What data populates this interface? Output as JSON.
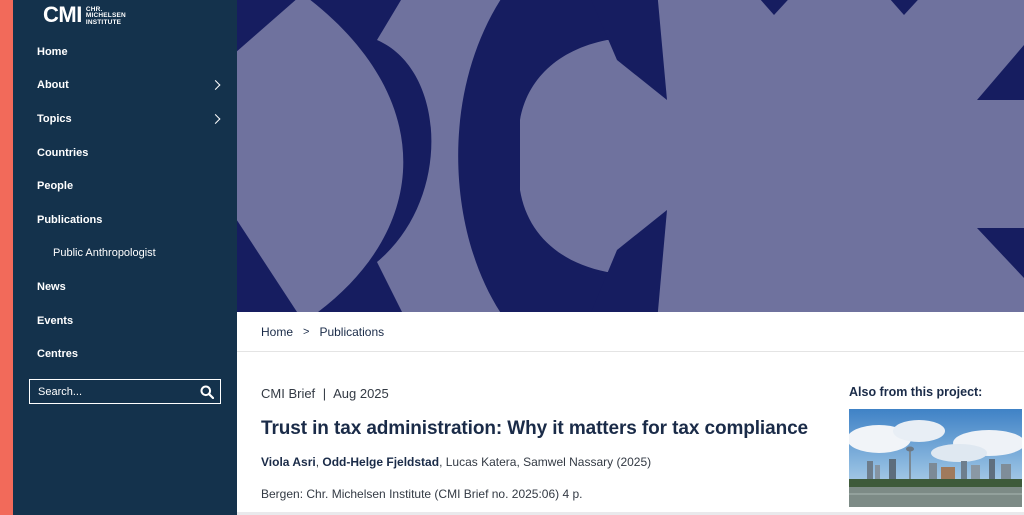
{
  "logo": {
    "mark": "CMI",
    "subtitle": "CHR.\nMICHELSEN\nINSTITUTE"
  },
  "nav": {
    "items": [
      {
        "label": "Home"
      },
      {
        "label": "About"
      },
      {
        "label": "Topics"
      },
      {
        "label": "Countries"
      },
      {
        "label": "People"
      },
      {
        "label": "Publications"
      },
      {
        "label": "Public Anthropologist"
      },
      {
        "label": "News"
      },
      {
        "label": "Events"
      },
      {
        "label": "Centres"
      }
    ]
  },
  "search": {
    "placeholder": "Search..."
  },
  "breadcrumb": {
    "home": "Home",
    "separator": ">",
    "current": "Publications"
  },
  "article": {
    "type": "CMI Brief",
    "divider": "|",
    "date": "Aug 2025",
    "title": "Trust in tax administration: Why it matters for tax compliance",
    "authors_linked": [
      "Viola Asri",
      "Odd-Helge Fjeldstad"
    ],
    "authors_rest": ", Lucas Katera, Samwel Nassary (2025)",
    "publication_info": "Bergen: Chr. Michelsen Institute (CMI Brief no. 2025:06) 4 p."
  },
  "aside": {
    "title": "Also from this project:"
  },
  "colors": {
    "sidebar": "#14324c",
    "accent": "#f26a5a",
    "hero_light": "#6f729e",
    "hero_dark": "#161d60",
    "text_dark": "#1a2b48"
  }
}
